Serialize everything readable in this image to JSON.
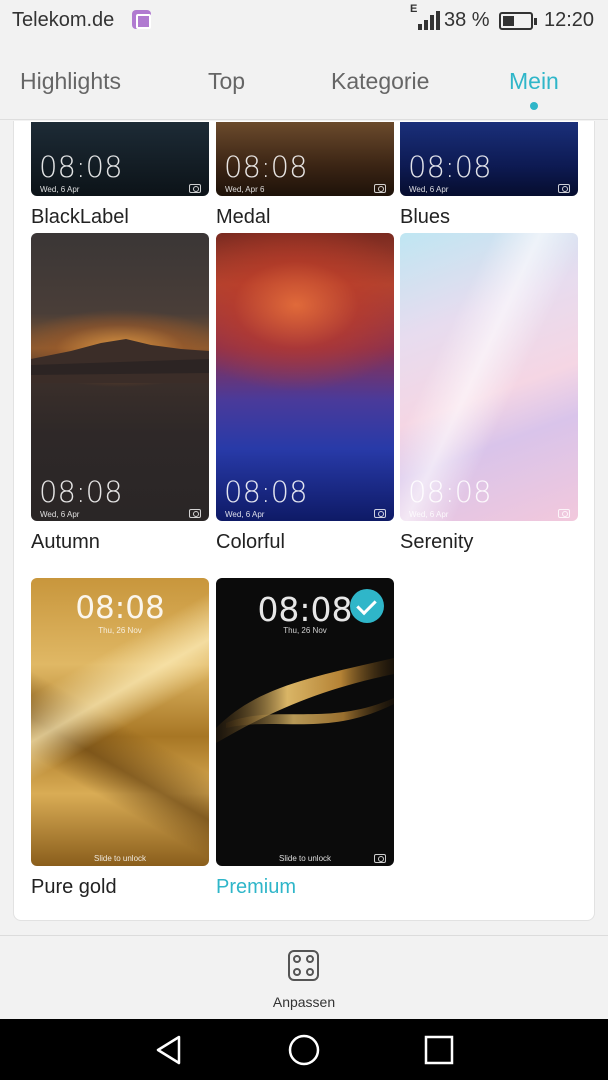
{
  "status_bar": {
    "carrier": "Telekom.de",
    "network_type": "E",
    "battery_percent": "38 %",
    "battery_level": 0.38,
    "time": "12:20",
    "icons": [
      "gallery-notification-icon",
      "signal-icon",
      "battery-icon"
    ]
  },
  "tabs": [
    {
      "label": "Highlights",
      "active": false
    },
    {
      "label": "Top",
      "active": false
    },
    {
      "label": "Kategorie",
      "active": false
    },
    {
      "label": "Mein",
      "active": true
    }
  ],
  "themes": [
    {
      "name": "BlackLabel",
      "clock": "08:08",
      "date": "Wed, 6 Apr"
    },
    {
      "name": "Medal",
      "clock": "08:08",
      "date": "Wed, Apr 6"
    },
    {
      "name": "Blues",
      "clock": "08:08",
      "date": "Wed, 6 Apr"
    },
    {
      "name": "Autumn",
      "clock": "08:08",
      "date": "Wed, 6 Apr"
    },
    {
      "name": "Colorful",
      "clock": "08:08",
      "date": "Wed, 6 Apr"
    },
    {
      "name": "Serenity",
      "clock": "08:08",
      "date": "Wed, 6 Apr"
    },
    {
      "name": "Pure gold",
      "clock": "08:08",
      "date": "Thu, 26 Nov",
      "slide": "Slide to unlock"
    },
    {
      "name": "Premium",
      "clock": "08:08",
      "date": "Thu, 26 Nov",
      "slide": "Slide to unlock",
      "selected": true
    }
  ],
  "action_bar": {
    "customize_label": "Anpassen",
    "icon": "customize-grid-icon"
  },
  "nav_bar": {
    "icons": [
      "back-icon",
      "home-icon",
      "recents-icon"
    ]
  },
  "colors": {
    "accent": "#2fb6c9",
    "background": "#f2f2f2"
  }
}
